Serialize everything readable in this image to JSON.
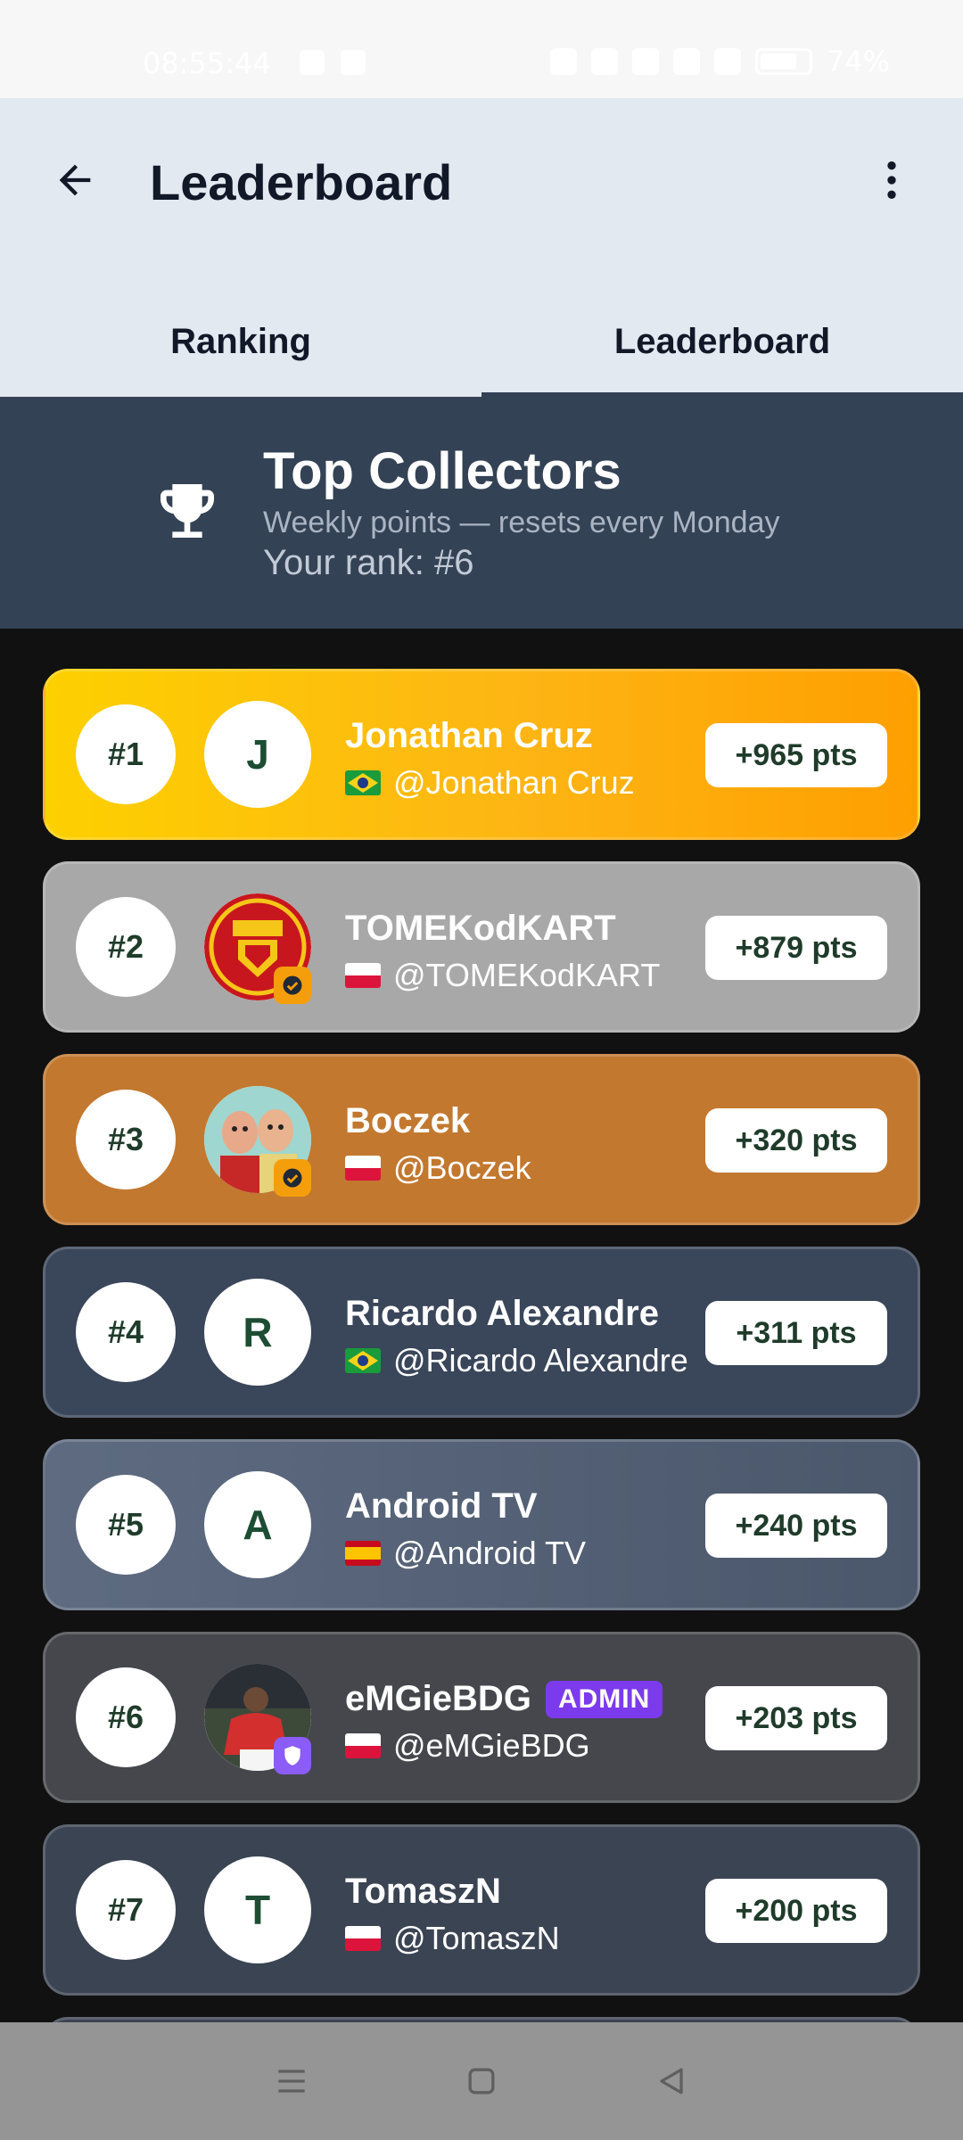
{
  "status_bar": {
    "time": "08:55:44",
    "battery": "74%"
  },
  "header": {
    "title": "Leaderboard"
  },
  "tabs": [
    {
      "label": "Ranking",
      "active": false
    },
    {
      "label": "Leaderboard",
      "active": true
    }
  ],
  "banner": {
    "title": "Top Collectors",
    "subtitle": "Weekly points — resets every Monday",
    "your_rank": "Your rank: #6"
  },
  "leaderboard": [
    {
      "rank": "#1",
      "avatar_letter": "J",
      "name": "Jonathan Cruz",
      "handle": "@Jonathan Cruz",
      "country": "brazil",
      "points": "+965 pts"
    },
    {
      "rank": "#2",
      "avatar_letter": "",
      "name": "TOMEKodKART",
      "handle": "@TOMEKodKART",
      "country": "poland",
      "points": "+879 pts",
      "verified": true
    },
    {
      "rank": "#3",
      "avatar_letter": "",
      "name": "Boczek",
      "handle": "@Boczek",
      "country": "poland",
      "points": "+320 pts",
      "verified": true
    },
    {
      "rank": "#4",
      "avatar_letter": "R",
      "name": "Ricardo Alexandre",
      "handle": "@Ricardo Alexandre",
      "country": "brazil",
      "points": "+311 pts"
    },
    {
      "rank": "#5",
      "avatar_letter": "A",
      "name": "Android TV",
      "handle": "@Android TV",
      "country": "spain",
      "points": "+240 pts"
    },
    {
      "rank": "#6",
      "avatar_letter": "",
      "name": "eMGieBDG",
      "badge": "ADMIN",
      "handle": "@eMGieBDG",
      "country": "poland",
      "points": "+203 pts"
    },
    {
      "rank": "#7",
      "avatar_letter": "T",
      "name": "TomaszN",
      "handle": "@TomaszN",
      "country": "poland",
      "points": "+200 pts"
    }
  ],
  "colors": {
    "header_bg": "#e3e9f1",
    "banner_bg": "#344255",
    "gold": "#fdc20a",
    "silver": "#a8a8a8",
    "bronze": "#c2782f",
    "admin": "#7c3aed",
    "points_text": "#1f3b2a"
  },
  "icons": [
    "back-arrow-icon",
    "more-vert-icon",
    "trophy-icon",
    "verified-icon",
    "shield-icon",
    "nav-menu-icon",
    "nav-home-icon",
    "nav-back-icon"
  ]
}
